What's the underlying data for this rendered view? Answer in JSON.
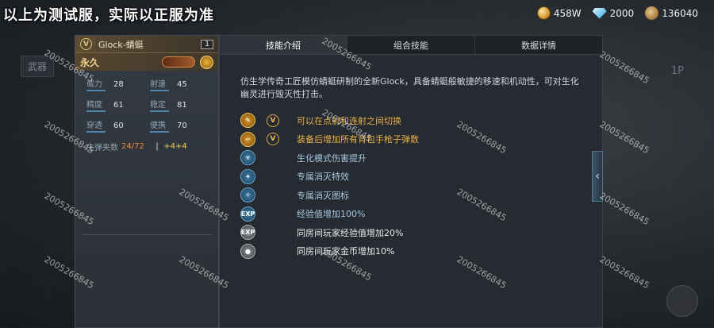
{
  "notice": "以上为测试服，实际以正服为准",
  "currencies": [
    {
      "icon": "gold-coin-icon",
      "value": "458W"
    },
    {
      "icon": "diamond-icon",
      "value": "2000"
    },
    {
      "icon": "medal-icon",
      "value": "136040"
    }
  ],
  "background": {
    "left_label": "武器",
    "right_label": "1P"
  },
  "weapon": {
    "name": "Glock-蜻蜓",
    "badge": "V",
    "count": "1",
    "duration": "永久",
    "stats": [
      {
        "label": "威力",
        "value": "28"
      },
      {
        "label": "射速",
        "value": "45"
      },
      {
        "label": "精度",
        "value": "61"
      },
      {
        "label": "稳定",
        "value": "81"
      },
      {
        "label": "穿透",
        "value": "60"
      },
      {
        "label": "便携",
        "value": "70"
      }
    ],
    "ammo_label": "主弹夹数",
    "ammo_value": "24/72",
    "ammo_bonus": "+4+4"
  },
  "tabs": [
    {
      "label": "技能介绍",
      "active": true
    },
    {
      "label": "组合技能",
      "active": false
    },
    {
      "label": "数据详情",
      "active": false
    }
  ],
  "description": "仿生学传奇工匠模仿蜻蜓研制的全新Glock，具备蜻蜓般敏捷的移速和机动性，可对生化幽灵进行毁灭性打击。",
  "skills": [
    {
      "icon": "fire-mode-icon",
      "style": "gold",
      "v_badge": true,
      "text": "可以在点射和连射之间切换"
    },
    {
      "icon": "pistol-ammo-icon",
      "style": "gold",
      "v_badge": true,
      "text": "装备后增加所有背包手枪子弹数"
    },
    {
      "icon": "biohazard-damage-icon",
      "style": "blue",
      "v_badge": false,
      "text": "生化模式伤害提升"
    },
    {
      "icon": "kill-effect-icon",
      "style": "blue",
      "v_badge": false,
      "text": "专属消灭特效"
    },
    {
      "icon": "kill-mark-icon",
      "style": "blue",
      "v_badge": false,
      "text": "专属消灭图标"
    },
    {
      "icon": "exp-icon",
      "style": "blue",
      "v_badge": false,
      "text": "经验值增加100%"
    },
    {
      "icon": "room-exp-icon",
      "style": "gray",
      "v_badge": false,
      "text": "同房间玩家经验值增加20%"
    },
    {
      "icon": "room-gold-icon",
      "style": "gray",
      "v_badge": false,
      "text": "同房间玩家金币增加10%"
    }
  ],
  "watermark": "2005266845"
}
